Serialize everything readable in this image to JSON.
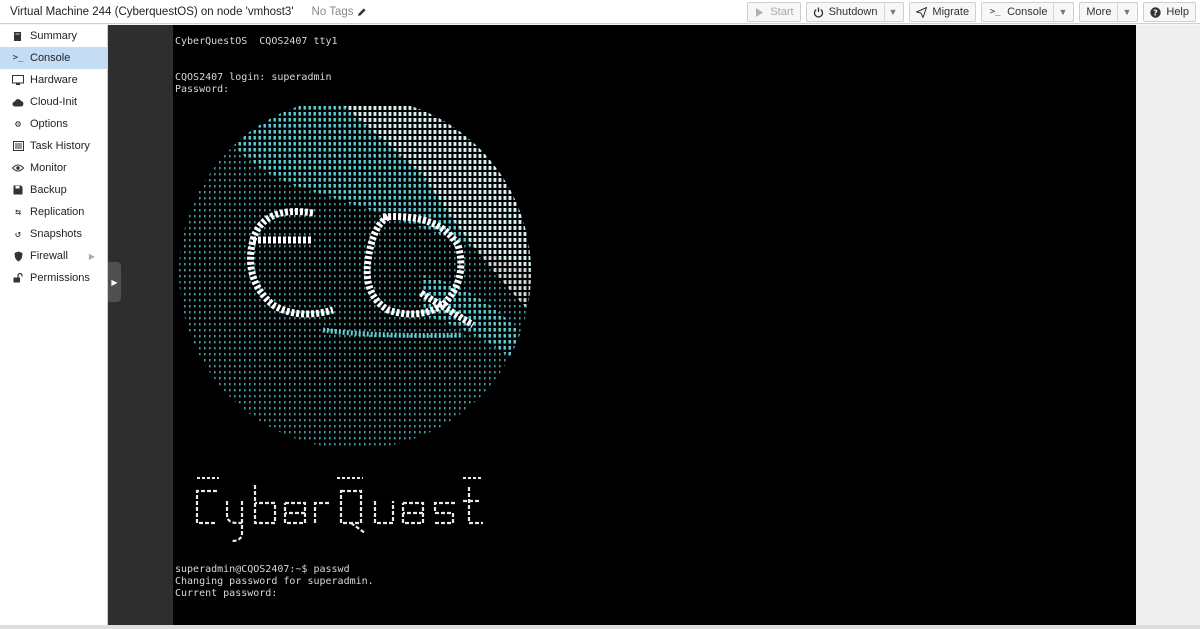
{
  "header": {
    "vm_title": "Virtual Machine 244 (CyberquestOS) on node 'vmhost3'",
    "tags_label": "No Tags",
    "buttons": {
      "start": "Start",
      "shutdown": "Shutdown",
      "migrate": "Migrate",
      "console": "Console",
      "more": "More",
      "help": "Help"
    }
  },
  "sidebar": {
    "items": [
      {
        "label": "Summary",
        "icon": "book-icon"
      },
      {
        "label": "Console",
        "icon": "terminal-icon"
      },
      {
        "label": "Hardware",
        "icon": "monitor-icon"
      },
      {
        "label": "Cloud-Init",
        "icon": "cloud-icon"
      },
      {
        "label": "Options",
        "icon": "gear-icon"
      },
      {
        "label": "Task History",
        "icon": "list-icon"
      },
      {
        "label": "Monitor",
        "icon": "eye-icon"
      },
      {
        "label": "Backup",
        "icon": "floppy-icon"
      },
      {
        "label": "Replication",
        "icon": "retweet-icon"
      },
      {
        "label": "Snapshots",
        "icon": "history-icon"
      },
      {
        "label": "Firewall",
        "icon": "shield-icon"
      },
      {
        "label": "Permissions",
        "icon": "unlock-icon"
      }
    ],
    "active_index": 1
  },
  "terminal": {
    "banner": "CyberQuestOS  CQOS2407 tty1",
    "login_prompt": "CQOS2407 login: superadmin",
    "password_prompt": "Password:",
    "shell_prompt": "superadmin@CQOS2407:~$ passwd",
    "passwd_msg": "Changing password for superadmin.",
    "current_pw": "Current password:"
  },
  "colors": {
    "accent_active": "#c4dcf4",
    "terminal_bg": "#000000",
    "art_cyan": "#6fe3e8",
    "art_white": "#f2f2f2"
  }
}
